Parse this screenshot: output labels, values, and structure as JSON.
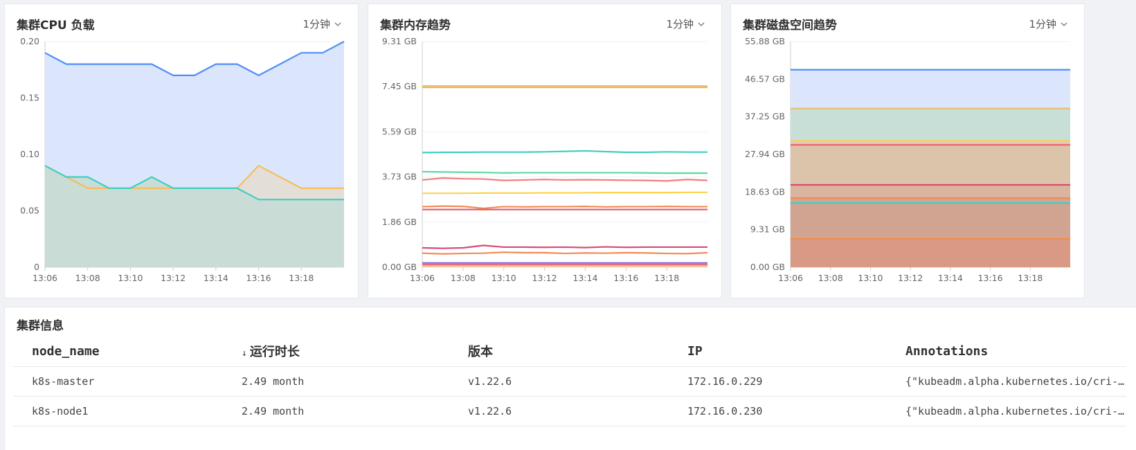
{
  "cpu": {
    "title": "集群CPU 负载",
    "interval": "1分钟",
    "chart_data": {
      "type": "area",
      "x": [
        "13:06",
        "13:07",
        "13:08",
        "13:09",
        "13:10",
        "13:11",
        "13:12",
        "13:13",
        "13:14",
        "13:15",
        "13:16",
        "13:17",
        "13:18",
        "13:19",
        "13:20"
      ],
      "x_ticks": [
        "13:06",
        "13:08",
        "13:10",
        "13:12",
        "13:14",
        "13:16",
        "13:18"
      ],
      "y_ticks": [
        "0",
        "0.05",
        "0.10",
        "0.15",
        "0.20"
      ],
      "ylim": [
        0,
        0.2
      ],
      "series": [
        {
          "color": "#4e8ef7",
          "fill": "#dbe6fd",
          "values": [
            0.19,
            0.18,
            0.18,
            0.18,
            0.18,
            0.18,
            0.17,
            0.17,
            0.18,
            0.18,
            0.17,
            0.18,
            0.19,
            0.19,
            0.2
          ]
        },
        {
          "color": "#f7bd59",
          "fill": "#e4ded8",
          "values": [
            0.09,
            0.08,
            0.07,
            0.07,
            0.07,
            0.07,
            0.07,
            0.07,
            0.07,
            0.07,
            0.09,
            0.08,
            0.07,
            0.07,
            0.07
          ]
        },
        {
          "color": "#3fcfc0",
          "fill": "#cadcd6",
          "values": [
            0.09,
            0.08,
            0.08,
            0.07,
            0.07,
            0.08,
            0.07,
            0.07,
            0.07,
            0.07,
            0.06,
            0.06,
            0.06,
            0.06,
            0.06
          ]
        }
      ]
    }
  },
  "memory": {
    "title": "集群内存趋势",
    "interval": "1分钟",
    "chart_data": {
      "type": "line",
      "x": [
        "13:06",
        "13:07",
        "13:08",
        "13:09",
        "13:10",
        "13:11",
        "13:12",
        "13:13",
        "13:14",
        "13:15",
        "13:16",
        "13:17",
        "13:18",
        "13:19",
        "13:20"
      ],
      "x_ticks": [
        "13:06",
        "13:08",
        "13:10",
        "13:12",
        "13:14",
        "13:16",
        "13:18"
      ],
      "y_ticks": [
        "0.00 GB",
        "1.86 GB",
        "3.73 GB",
        "5.59 GB",
        "7.45 GB",
        "9.31 GB"
      ],
      "ylim": [
        0,
        9.31
      ],
      "series": [
        {
          "color": "#f5c07a",
          "values": [
            7.48,
            7.48,
            7.48,
            7.48,
            7.48,
            7.48,
            7.48,
            7.48,
            7.48,
            7.48,
            7.48,
            7.48,
            7.48,
            7.48,
            7.48
          ]
        },
        {
          "color": "#e8b25a",
          "values": [
            7.42,
            7.42,
            7.42,
            7.42,
            7.42,
            7.42,
            7.42,
            7.42,
            7.42,
            7.42,
            7.42,
            7.42,
            7.42,
            7.42,
            7.42
          ]
        },
        {
          "color": "#3ccfc0",
          "values": [
            4.73,
            4.74,
            4.74,
            4.75,
            4.75,
            4.75,
            4.76,
            4.78,
            4.8,
            4.77,
            4.74,
            4.74,
            4.76,
            4.75,
            4.75
          ]
        },
        {
          "color": "#5ed8a4",
          "values": [
            3.94,
            3.93,
            3.92,
            3.91,
            3.89,
            3.9,
            3.9,
            3.9,
            3.9,
            3.9,
            3.9,
            3.89,
            3.88,
            3.88,
            3.88
          ]
        },
        {
          "color": "#f47c7c",
          "values": [
            3.6,
            3.68,
            3.65,
            3.64,
            3.58,
            3.6,
            3.62,
            3.6,
            3.61,
            3.6,
            3.59,
            3.58,
            3.56,
            3.62,
            3.58
          ]
        },
        {
          "color": "#fcd34d",
          "values": [
            3.05,
            3.05,
            3.05,
            3.06,
            3.06,
            3.06,
            3.07,
            3.07,
            3.07,
            3.08,
            3.08,
            3.08,
            3.08,
            3.09,
            3.09
          ]
        },
        {
          "color": "#f28a56",
          "values": [
            2.5,
            2.52,
            2.51,
            2.43,
            2.5,
            2.49,
            2.5,
            2.5,
            2.51,
            2.49,
            2.5,
            2.5,
            2.51,
            2.5,
            2.5
          ]
        },
        {
          "color": "#e06065",
          "values": [
            2.38,
            2.38,
            2.38,
            2.38,
            2.38,
            2.38,
            2.38,
            2.38,
            2.38,
            2.38,
            2.38,
            2.38,
            2.38,
            2.38,
            2.38
          ]
        },
        {
          "color": "#d94a7a",
          "values": [
            0.8,
            0.78,
            0.8,
            0.9,
            0.83,
            0.83,
            0.82,
            0.83,
            0.81,
            0.84,
            0.82,
            0.83,
            0.83,
            0.83,
            0.83
          ]
        },
        {
          "color": "#f28a56",
          "values": [
            0.58,
            0.55,
            0.57,
            0.58,
            0.62,
            0.6,
            0.6,
            0.57,
            0.59,
            0.58,
            0.6,
            0.59,
            0.57,
            0.56,
            0.6
          ]
        },
        {
          "color": "#8e6fe0",
          "values": [
            0.18,
            0.18,
            0.18,
            0.18,
            0.18,
            0.18,
            0.18,
            0.18,
            0.18,
            0.18,
            0.18,
            0.18,
            0.18,
            0.18,
            0.18
          ]
        },
        {
          "color": "#e85a80",
          "values": [
            0.12,
            0.12,
            0.12,
            0.12,
            0.12,
            0.12,
            0.12,
            0.12,
            0.12,
            0.12,
            0.12,
            0.12,
            0.12,
            0.12,
            0.12
          ]
        },
        {
          "color": "#f5b06a",
          "values": [
            0.06,
            0.06,
            0.06,
            0.06,
            0.06,
            0.06,
            0.06,
            0.06,
            0.06,
            0.06,
            0.06,
            0.06,
            0.06,
            0.06,
            0.06
          ]
        }
      ]
    }
  },
  "disk": {
    "title": "集群磁盘空间趋势",
    "interval": "1分钟",
    "chart_data": {
      "type": "area",
      "x": [
        "13:06",
        "13:07",
        "13:08",
        "13:09",
        "13:10",
        "13:11",
        "13:12",
        "13:13",
        "13:14",
        "13:15",
        "13:16",
        "13:17",
        "13:18",
        "13:19",
        "13:20"
      ],
      "x_ticks": [
        "13:06",
        "13:08",
        "13:10",
        "13:12",
        "13:14",
        "13:16",
        "13:18"
      ],
      "y_ticks": [
        "0.00 GB",
        "9.31 GB",
        "18.63 GB",
        "27.94 GB",
        "37.25 GB",
        "46.57 GB",
        "55.88 GB"
      ],
      "ylim": [
        0,
        55.88
      ],
      "series": [
        {
          "color": "#4e8ef7",
          "fill": "#dbe6fd",
          "value": 48.9
        },
        {
          "color": "#e8c070",
          "fill": "#c8dfd8",
          "value": 39.3
        },
        {
          "color": "#f5d070",
          "fill": "#e0cdb4",
          "value": 31.4
        },
        {
          "color": "#f06070",
          "fill": "#dbc4aa",
          "value": 30.3
        },
        {
          "color": "#d94a70",
          "fill": "#d9b5a0",
          "value": 20.4
        },
        {
          "color": "#f28a56",
          "fill": "#d3a694",
          "value": 17.1
        },
        {
          "color": "#3ccfc0",
          "fill": "#d0a490",
          "value": 15.9
        },
        {
          "color": "#f58a40",
          "fill": "#d89a84",
          "value": 7.0
        }
      ]
    }
  },
  "cluster": {
    "title": "集群信息",
    "columns": [
      "node_name",
      "运行时长",
      "版本",
      "IP",
      "Annotations"
    ],
    "sort_indicator": "↓",
    "rows": [
      [
        "k8s-master",
        "2.49 month",
        "v1.22.6",
        "172.16.0.229",
        "{\"kubeadm.alpha.kubernetes.io/cri-socket\":\"/var/run/dockershim.sock\"}"
      ],
      [
        "k8s-node1",
        "2.49 month",
        "v1.22.6",
        "172.16.0.230",
        "{\"kubeadm.alpha.kubernetes.io/cri-socket\":\"/var/run/dockershim.sock\"}"
      ]
    ]
  }
}
